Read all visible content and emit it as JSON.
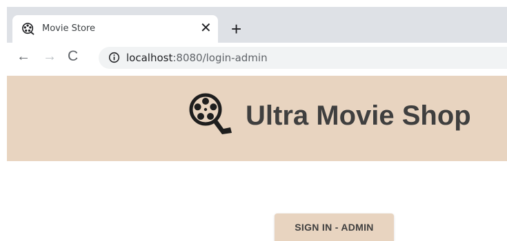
{
  "browser": {
    "tab": {
      "title": "Movie Store",
      "close_label": "✕",
      "icon": "film-reel-icon"
    },
    "new_tab_label": "+",
    "nav": {
      "back": "←",
      "forward": "→",
      "reload": "C"
    },
    "address": {
      "host": "localhost",
      "rest": ":8080/login-admin",
      "icon": "info-icon"
    }
  },
  "header": {
    "title": "Ultra Movie Shop",
    "logo": "film-reel-icon",
    "background": "#e8d4c0"
  },
  "main": {
    "signin_button": "SIGN IN - ADMIN"
  }
}
